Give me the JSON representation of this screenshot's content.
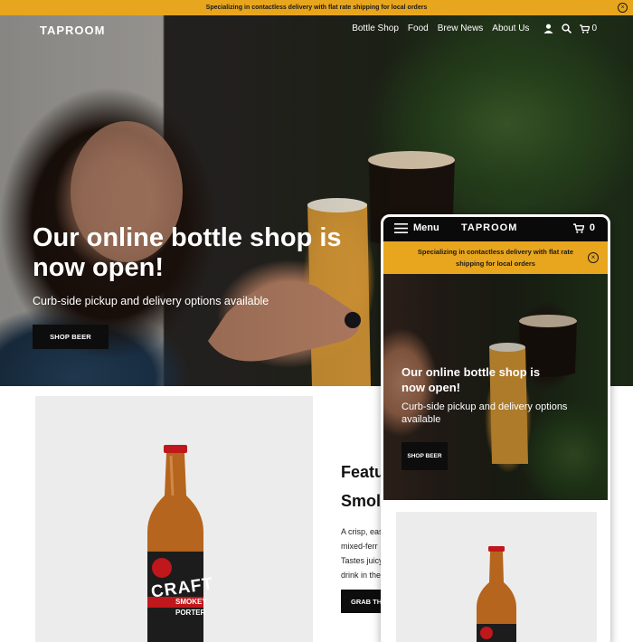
{
  "announcement": {
    "text": "Specializing in contactless delivery with flat rate shipping for local orders",
    "close_glyph": "×"
  },
  "nav": {
    "logo": "TAPROOM",
    "links": [
      "Bottle Shop",
      "Food",
      "Brew News",
      "About Us"
    ],
    "icons": [
      "account-icon",
      "search-icon",
      "cart-icon"
    ],
    "cart_count": "0"
  },
  "hero": {
    "title": "Our online bottle shop is now open!",
    "subtitle": "Curb-side pickup and delivery options available",
    "button": "SHOP BEER"
  },
  "featured": {
    "title": "Featu",
    "product_name": "Smol",
    "description_lines": [
      "A crisp, eas",
      "mixed-ferr",
      "Tastes juicy",
      "drink in the"
    ],
    "button": "GRAB THE",
    "label_top": "CRAFT",
    "label_sub1": "SMOKEY",
    "label_sub2": "PORTER"
  },
  "mobile": {
    "menu_label": "Menu",
    "logo": "TAPROOM",
    "cart_count": "0",
    "announcement": "Specializing in contactless delivery with flat rate shipping for local orders",
    "hero_title": "Our online bottle shop is now open!",
    "hero_subtitle": "Curb-side pickup and delivery options available",
    "hero_button": "SHOP BEER"
  },
  "colors": {
    "announcement_bg": "#e8a61e",
    "button_bg": "#0d0d0d",
    "panel_bg": "#ececec",
    "bottle_glass": "#b5651d",
    "bottle_cap": "#c0171c",
    "label_bg": "#1c1c1c",
    "label_accent": "#c0171c"
  }
}
